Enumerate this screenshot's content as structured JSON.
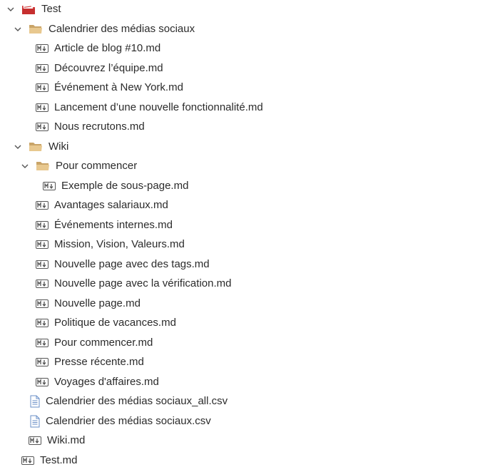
{
  "tree": {
    "root": {
      "label": "Test",
      "icon": "book-icon",
      "expanded": true
    },
    "calendrier_folder": {
      "label": "Calendrier des médias sociaux",
      "icon": "folder-icon",
      "expanded": true
    },
    "calendrier_files": [
      "Article de blog #10.md",
      "Découvrez l’équipe.md",
      "Événement à New York.md",
      "Lancement d’une nouvelle fonctionnalité.md",
      "Nous recrutons.md"
    ],
    "wiki_folder": {
      "label": "Wiki",
      "icon": "folder-icon",
      "expanded": true
    },
    "pour_commencer_folder": {
      "label": "Pour commencer",
      "icon": "folder-icon",
      "expanded": true
    },
    "pour_commencer_files": [
      "Exemple de sous-page.md"
    ],
    "wiki_files": [
      "Avantages salariaux.md",
      "Événements internes.md",
      "Mission, Vision, Valeurs.md",
      "Nouvelle page avec des tags.md",
      "Nouvelle page avec la vérification.md",
      "Nouvelle page.md",
      "Politique de vacances.md",
      "Pour commencer.md",
      "Presse récente.md",
      "Voyages d'affaires.md"
    ],
    "csv_files": [
      "Calendrier des médias sociaux_all.csv",
      "Calendrier des médias sociaux.csv"
    ],
    "wiki_md": "Wiki.md",
    "test_md": "Test.md"
  },
  "colors": {
    "text": "#2b2b2b",
    "chevron": "#555555",
    "folder": "#dcb67a",
    "book": "#d13a3a",
    "md_icon": "#555555",
    "doc_icon": "#6a8fc7"
  }
}
